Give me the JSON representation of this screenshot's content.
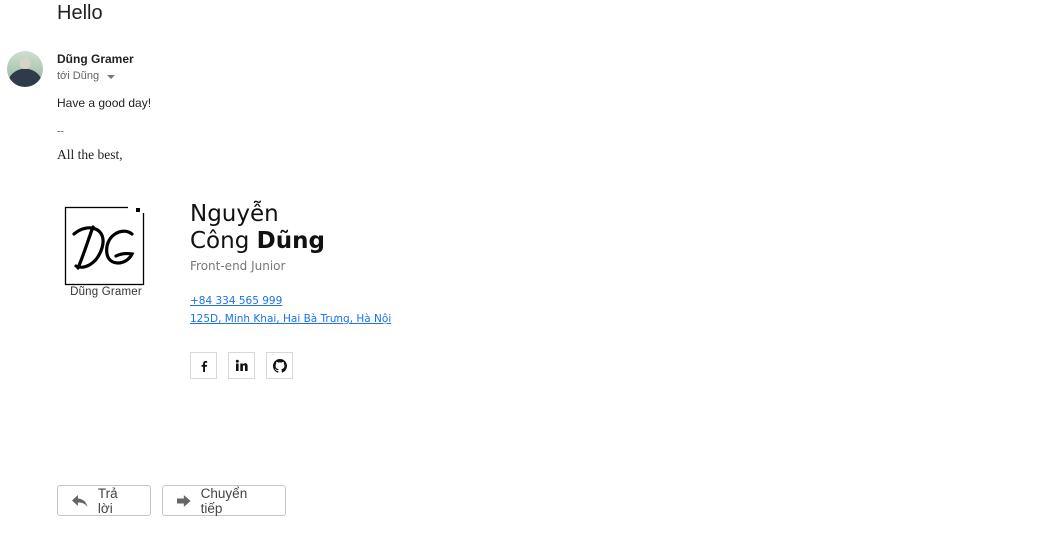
{
  "email": {
    "subject": "Hello",
    "sender_name": "Dũng Gramer",
    "recipient_line": "tới Dũng",
    "body": "Have a good day!",
    "signature_separator": "--",
    "closing": "All the best,"
  },
  "signature": {
    "logo_caption": "Dũng Gramer",
    "first_name": "Nguyễn",
    "middle_name": "Công",
    "last_name": "Dũng",
    "role": "Front-end Junior",
    "phone": "+84 334 565 999",
    "address": "125D, Minh Khai, Hai Bà Trưng, Hà Nội",
    "social_links": [
      {
        "icon": "facebook-icon"
      },
      {
        "icon": "linkedin-icon"
      },
      {
        "icon": "github-icon"
      }
    ]
  },
  "actions": {
    "reply_label": "Trả lời",
    "forward_label": "Chuyển tiếp"
  },
  "colors": {
    "link": "#1a73e8"
  }
}
